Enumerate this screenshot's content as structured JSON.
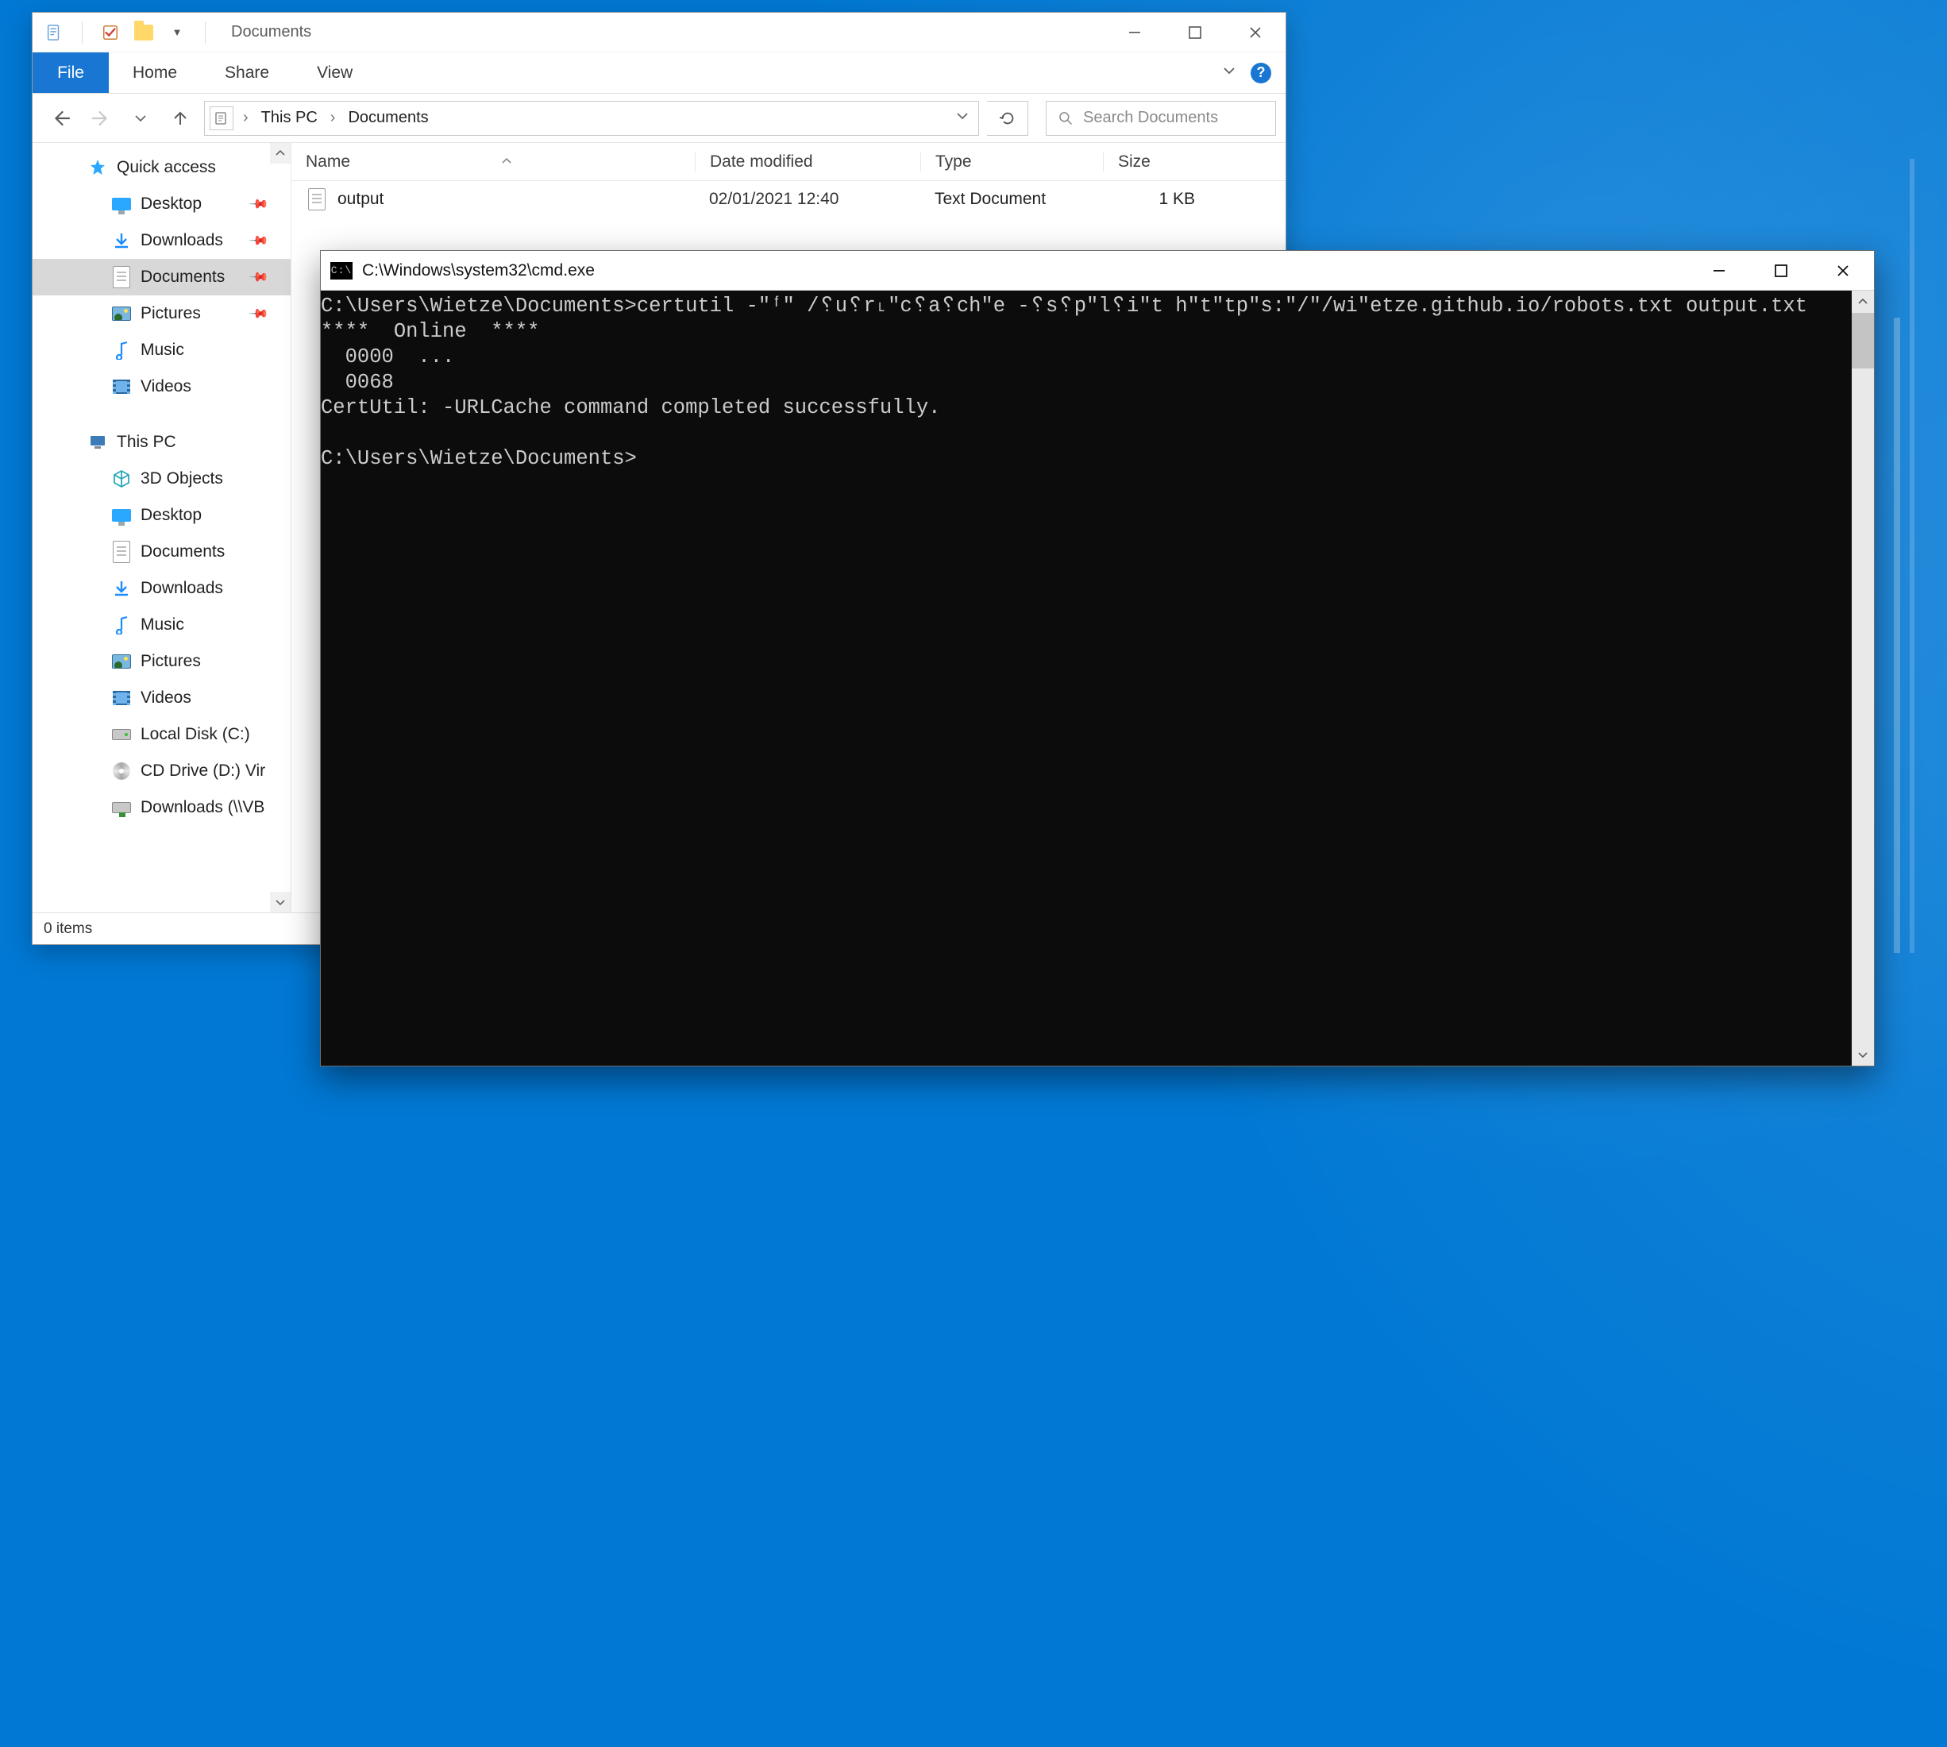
{
  "explorer": {
    "title": "Documents",
    "ribbon": {
      "file": "File",
      "tabs": [
        "Home",
        "Share",
        "View"
      ],
      "help": "?"
    },
    "breadcrumb": {
      "root_chev": "›",
      "items": [
        "This PC",
        "Documents"
      ]
    },
    "search_placeholder": "Search Documents",
    "columns": {
      "name": "Name",
      "date": "Date modified",
      "type": "Type",
      "size": "Size"
    },
    "nav": {
      "quick_access": {
        "label": "Quick access",
        "items": [
          {
            "id": "desktop",
            "label": "Desktop",
            "pinned": true,
            "icon": "monitor"
          },
          {
            "id": "downloads",
            "label": "Downloads",
            "pinned": true,
            "icon": "arrow-down"
          },
          {
            "id": "documents",
            "label": "Documents",
            "pinned": true,
            "icon": "text-doc",
            "selected": true
          },
          {
            "id": "pictures",
            "label": "Pictures",
            "pinned": true,
            "icon": "pic"
          },
          {
            "id": "music",
            "label": "Music",
            "pinned": false,
            "icon": "music"
          },
          {
            "id": "videos",
            "label": "Videos",
            "pinned": false,
            "icon": "film"
          }
        ]
      },
      "this_pc": {
        "label": "This PC",
        "items": [
          {
            "id": "3dobjects",
            "label": "3D Objects",
            "icon": "cube"
          },
          {
            "id": "desktop2",
            "label": "Desktop",
            "icon": "monitor"
          },
          {
            "id": "documents2",
            "label": "Documents",
            "icon": "text-doc"
          },
          {
            "id": "downloads2",
            "label": "Downloads",
            "icon": "arrow-down"
          },
          {
            "id": "music2",
            "label": "Music",
            "icon": "music"
          },
          {
            "id": "pictures2",
            "label": "Pictures",
            "icon": "pic"
          },
          {
            "id": "videos2",
            "label": "Videos",
            "icon": "film"
          },
          {
            "id": "cdrive",
            "label": "Local Disk (C:)",
            "icon": "drive"
          },
          {
            "id": "ddrive",
            "label": "CD Drive (D:) Vir",
            "icon": "cd"
          },
          {
            "id": "netdl",
            "label": "Downloads (\\\\VB",
            "icon": "net-drive"
          }
        ]
      }
    },
    "rows": [
      {
        "name": "output",
        "date": "02/01/2021 12:40",
        "type": "Text Document",
        "size": "1 KB"
      }
    ],
    "status": "0 items"
  },
  "cmd": {
    "title": "C:\\Windows\\system32\\cmd.exe",
    "lines": [
      "C:\\Users\\Wietze\\Documents>certutil -\"ᶠ\" /␦u␦r˪\"c␦a␦ch\"e -␦s␦p\"l␦i\"t h\"t\"tp\"s:\"/\"/wi\"etze.github.io/robots.txt output.txt",
      "****  Online  ****",
      "  0000  ...",
      "  0068",
      "CertUtil: -URLCache command completed successfully.",
      "",
      "C:\\Users\\Wietze\\Documents>"
    ]
  }
}
